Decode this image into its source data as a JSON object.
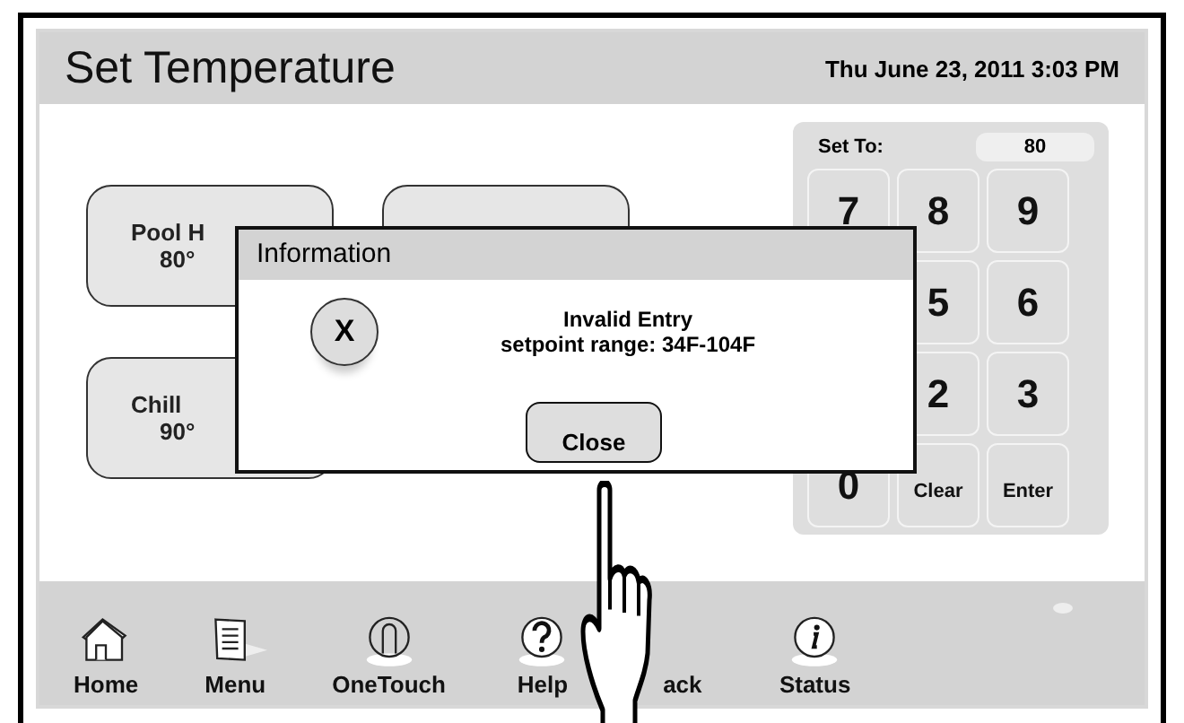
{
  "header": {
    "title": "Set Temperature",
    "datetime": "Thu June 23, 2011  3:03 PM"
  },
  "tiles": [
    {
      "kind": "labeled",
      "name": "Pool H",
      "value": "80°"
    },
    {
      "kind": "blank"
    },
    {
      "kind": "labeled",
      "name": "Chill",
      "value": "90°"
    }
  ],
  "keypad": {
    "label": "Set To:",
    "value": "80",
    "rows": [
      [
        "7",
        "8",
        "9"
      ],
      [
        "5",
        "6"
      ],
      [
        "2",
        "3"
      ],
      [
        "0",
        "Clear",
        "Enter"
      ]
    ]
  },
  "dialog": {
    "title": "Information",
    "icon": "X",
    "message": [
      "Invalid Entry",
      "setpoint range: 34F-104F"
    ],
    "button": "Close"
  },
  "nav": [
    {
      "kind": "home",
      "label": "Home"
    },
    {
      "kind": "menu",
      "label": "Menu"
    },
    {
      "kind": "onetouch",
      "label": "OneTouch"
    },
    {
      "kind": "help",
      "label": "Help"
    },
    {
      "kind": "back",
      "label": "ack"
    },
    {
      "kind": "status",
      "label": "Status"
    }
  ]
}
